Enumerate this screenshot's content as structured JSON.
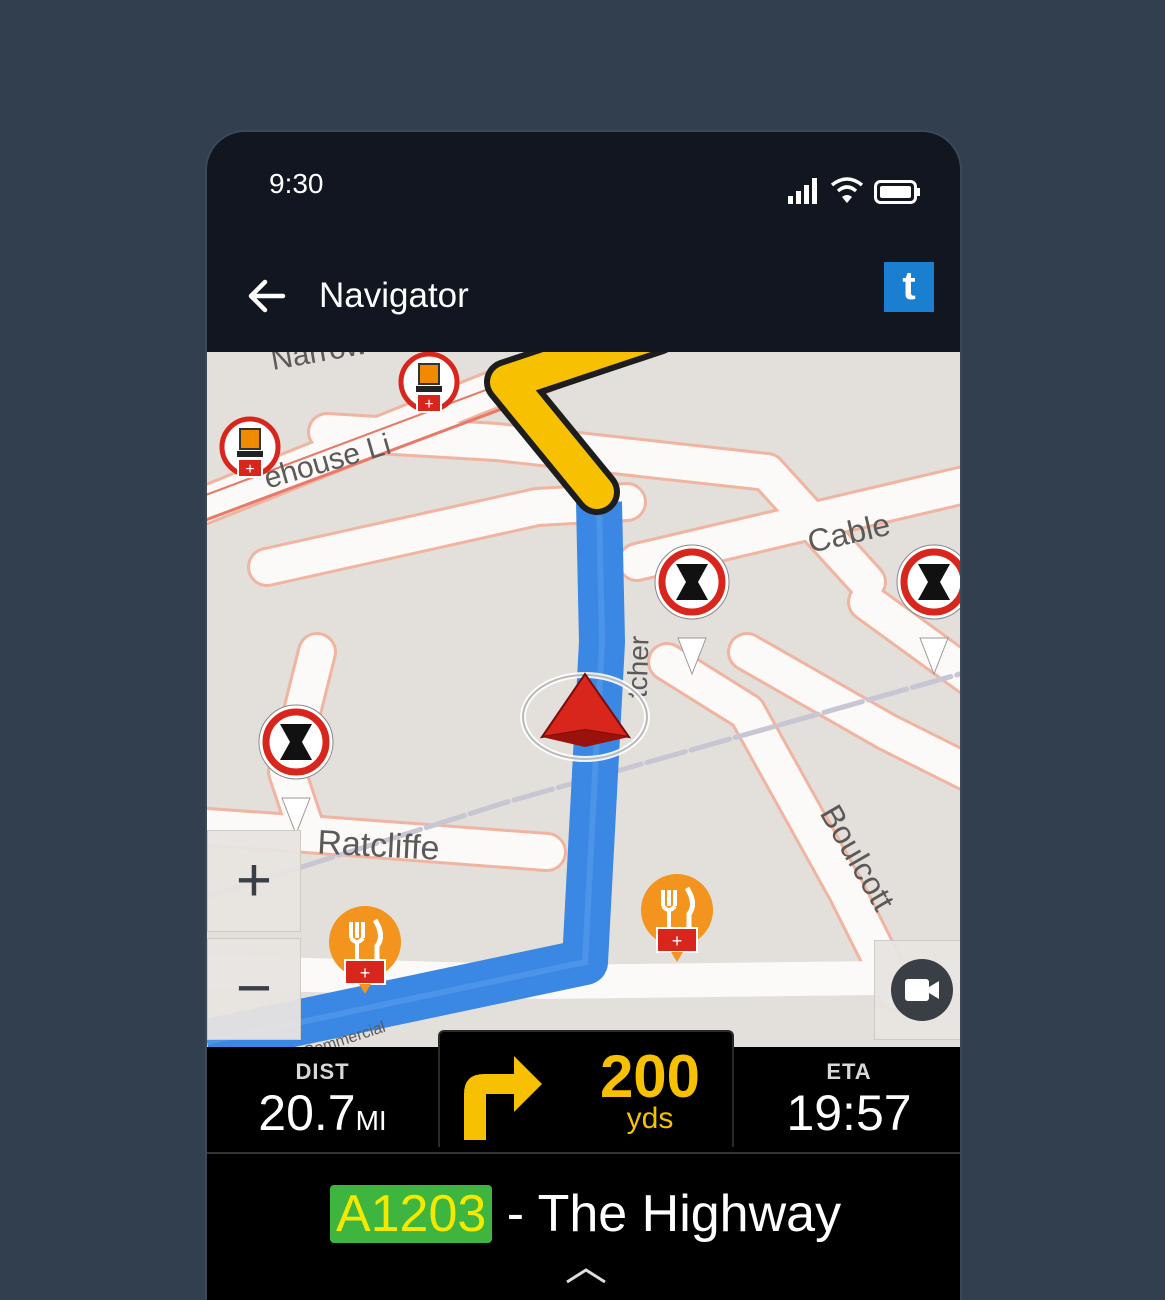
{
  "status": {
    "time": "9:30"
  },
  "appbar": {
    "title": "Navigator",
    "logo": "t"
  },
  "map": {
    "street_labels": [
      "Narrow",
      "ehouse Li",
      "Cable",
      "tcher",
      "Ratcliffe",
      "Boulcott",
      "Commercial"
    ]
  },
  "controls": {
    "zoom_in": "+",
    "zoom_out": "−"
  },
  "nav": {
    "dist_label": "DIST",
    "dist_value": "20.7",
    "dist_unit": "MI",
    "turn_distance": "200",
    "turn_unit": "yds",
    "eta_label": "ETA",
    "eta_value": "19:57"
  },
  "road": {
    "badge": "A1203",
    "separator": " - ",
    "name": "The Highway"
  },
  "colors": {
    "route": "#3a87e4",
    "turn_arrow": "#f7c000",
    "road_badge": "#3db53e",
    "accent": "#1a7fd0"
  }
}
